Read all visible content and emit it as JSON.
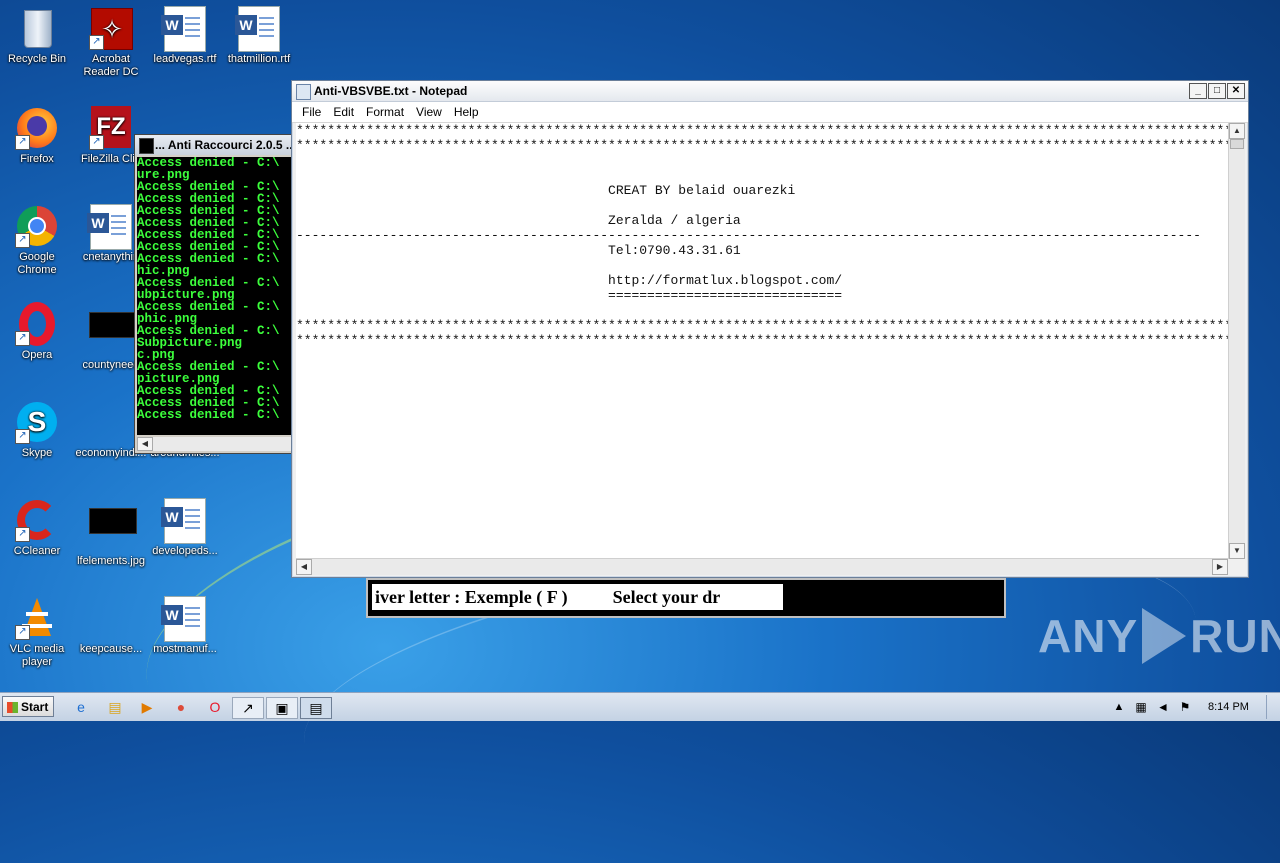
{
  "desktop": {
    "icons": [
      {
        "label": "Recycle Bin"
      },
      {
        "label": "Acrobat Reader DC"
      },
      {
        "label": "leadvegas.rtf"
      },
      {
        "label": "thatmillion.rtf"
      },
      {
        "label": "Firefox"
      },
      {
        "label": "FileZilla Clie"
      },
      {
        "label": "Google Chrome"
      },
      {
        "label": "cnetanythin"
      },
      {
        "label": "Opera"
      },
      {
        "label": "countyneed"
      },
      {
        "label": "Skype"
      },
      {
        "label": "economyindi..."
      },
      {
        "label": "aroundmiles..."
      },
      {
        "label": "CCleaner"
      },
      {
        "label": "lfelements.jpg"
      },
      {
        "label": "developeds..."
      },
      {
        "label": "VLC media player"
      },
      {
        "label": "keepcause..."
      },
      {
        "label": "mostmanuf..."
      }
    ]
  },
  "cmd": {
    "title": "... Anti Raccourci 2.0.5 ...",
    "lines": [
      "Access denied - C:\\",
      "ure.png",
      "Access denied - C:\\",
      "Access denied - C:\\",
      "Access denied - C:\\",
      "Access denied - C:\\",
      "Access denied - C:\\",
      "Access denied - C:\\",
      "Access denied - C:\\",
      "hic.png",
      "Access denied - C:\\",
      "ubpicture.png",
      "Access denied - C:\\",
      "phic.png",
      "Access denied - C:\\",
      "Subpicture.png",
      "c.png",
      "Access denied - C:\\",
      "picture.png",
      "Access denied - C:\\",
      "Access denied - C:\\",
      "Access denied - C:\\"
    ]
  },
  "notepad": {
    "title": "Anti-VBSVBE.txt - Notepad",
    "menu": [
      "File",
      "Edit",
      "Format",
      "View",
      "Help"
    ],
    "content": "*****************************************************************************************************************************\n*****************************************************************************************************************************\n\n\n                                        CREAT BY belaid ouarezki\n\n                                        Zeralda / algeria\n--------------------------------------------------------------------------------------------------------------------\n                                        Tel:0790.43.31.61\n\n                                        http://formatlux.blogspot.com/\n                                        ==============================\n\n*****************************************************************************************************************************\n*****************************************************************************************************************************"
  },
  "console_strip": {
    "text": "iver letter : Exemple ( F )          Select your dr"
  },
  "watermark": {
    "left": "ANY",
    "right": "RUN"
  },
  "taskbar": {
    "start_label": "Start",
    "clock": "8:14 PM"
  }
}
